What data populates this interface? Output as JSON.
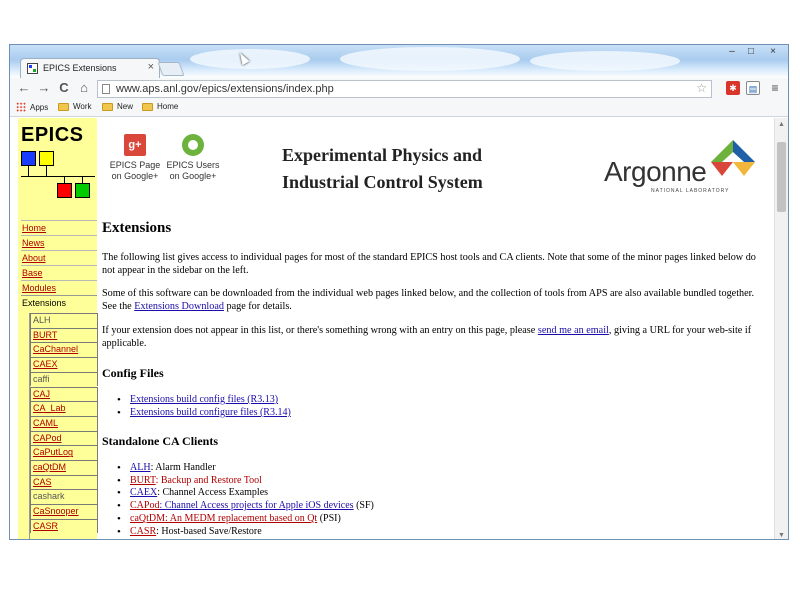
{
  "browser": {
    "tab_title": "EPICS Extensions",
    "tab_close": "×",
    "window_controls": [
      "–",
      "□",
      "×"
    ],
    "url": "www.aps.anl.gov/epics/extensions/index.php",
    "nav": {
      "back": "←",
      "forward": "→",
      "reload": "C",
      "home": "⌂"
    },
    "star": "☆",
    "bookmarks": [
      "Apps",
      "Work",
      "New",
      "Home"
    ]
  },
  "header": {
    "logo": "EPICS",
    "gplus_icon": "g+",
    "gplus_label": [
      "EPICS Page",
      "on Google+"
    ],
    "users_label": [
      "EPICS Users",
      "on Google+"
    ],
    "title_lines": [
      "Experimental Physics and",
      "Industrial Control System"
    ],
    "argonne": "Argonne",
    "argonne_sub": "NATIONAL LABORATORY",
    "argonne_colors": [
      "#6cb23d",
      "#1f5fa8",
      "#d9473a",
      "#f2b63a"
    ]
  },
  "sidebar": {
    "items": [
      "Home",
      "News",
      "About",
      "Base",
      "Modules",
      "Extensions"
    ],
    "active": "Extensions",
    "sub_items": [
      {
        "label": "ALH",
        "link": false
      },
      {
        "label": "BURT",
        "link": true
      },
      {
        "label": "CaChannel",
        "link": true
      },
      {
        "label": "CAEX",
        "link": true
      },
      {
        "label": "caffi",
        "link": false
      },
      {
        "label": "CAJ",
        "link": true
      },
      {
        "label": "CA_Lab",
        "link": true
      },
      {
        "label": "CAML",
        "link": true
      },
      {
        "label": "CAPod",
        "link": true
      },
      {
        "label": "CaPutLog",
        "link": true
      },
      {
        "label": "caQtDM",
        "link": true
      },
      {
        "label": "CAS",
        "link": true
      },
      {
        "label": "cashark",
        "link": false
      },
      {
        "label": "CaSnooper",
        "link": true
      },
      {
        "label": "CASR",
        "link": true
      }
    ]
  },
  "content": {
    "title": "Extensions",
    "p1": "The following list gives access to individual pages for most of the standard EPICS host tools and CA clients. Note that some of the minor pages linked below do not appear in the sidebar on the left.",
    "p2_pre": "Some of this software can be downloaded from the individual web pages linked below, and the collection of tools from APS are also available bundled together. See the",
    "p2_link": "Extensions Download",
    "p2_post": "page for details.",
    "p3_pre": "If your extension does not appear in this list, or there's something wrong with an entry on this page, please",
    "p3_link": "send me an email",
    "p3_post": ", giving a URL for your web-site if applicable.",
    "section1": "Config Files",
    "config_files": [
      {
        "text": "Extensions build config files (R3.13)"
      },
      {
        "text": "Extensions build configure files (R3.14)"
      }
    ],
    "section2": "Standalone CA Clients",
    "clients": [
      {
        "link": "ALH",
        "rest": ": Alarm Handler"
      },
      {
        "link": "BURT",
        "rest": ": Backup and Restore Tool"
      },
      {
        "link": "CAEX",
        "rest": ": Channel Access Examples"
      },
      {
        "link": "CAPod",
        "rest": ": Channel Access projects for Apple iOS devices",
        "suffix": " (SF)"
      },
      {
        "link": "caQtDM",
        "rest": ": An MEDM replacement based on Qt",
        "suffix": " (PSI)"
      },
      {
        "link": "CASR",
        "rest": ": Host-based Save/Restore"
      }
    ]
  }
}
